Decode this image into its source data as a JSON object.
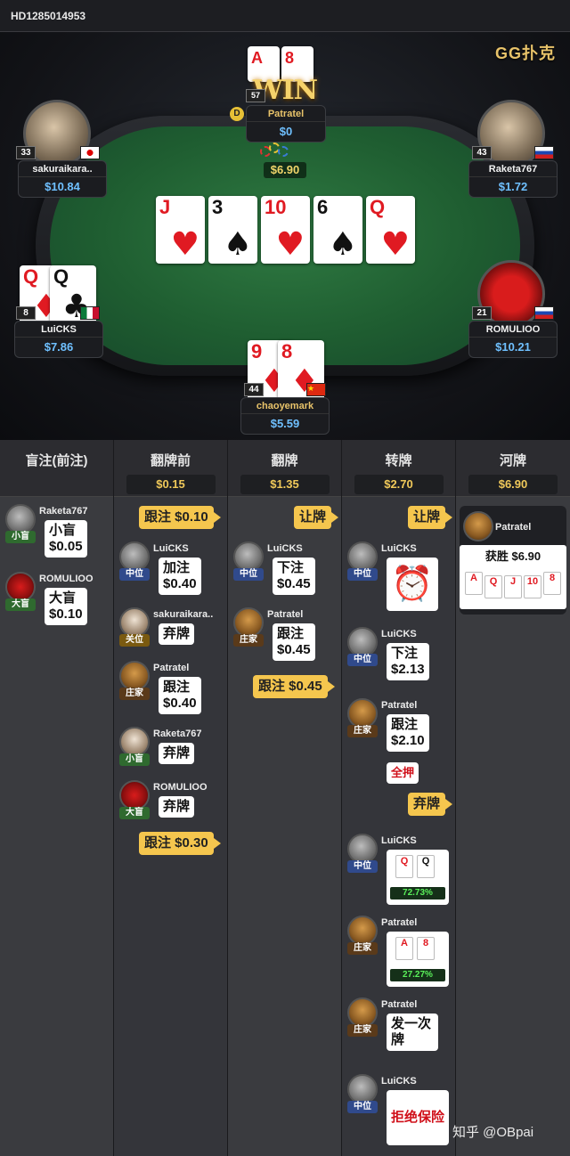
{
  "hand_id": "HD1285014953",
  "brand": "GG扑克",
  "win_badge": "WIN",
  "winner_cards": [
    {
      "rank": "A",
      "suit": "♦"
    },
    {
      "rank": "8",
      "suit": "♥"
    }
  ],
  "pot": "$6.90",
  "players": {
    "top": {
      "name": "Patratel",
      "stack": "$0",
      "level": "57",
      "dealer": "D"
    },
    "top_left": {
      "name": "sakuraikara..",
      "stack": "$10.84",
      "level": "33"
    },
    "top_right": {
      "name": "Raketa767",
      "stack": "$1.72",
      "level": "43"
    },
    "mid_left": {
      "name": "LuiCKS",
      "stack": "$7.86",
      "level": "8",
      "cards": [
        {
          "rank": "Q",
          "suit": "♦"
        },
        {
          "rank": "Q",
          "suit": "♣"
        }
      ]
    },
    "mid_right": {
      "name": "ROMULIOO",
      "stack": "$10.21",
      "level": "21"
    },
    "bottom": {
      "name": "chaoyemark",
      "stack": "$5.59",
      "level": "44",
      "cards": [
        {
          "rank": "9",
          "suit": "♦"
        },
        {
          "rank": "8",
          "suit": "♦"
        }
      ]
    }
  },
  "board": [
    {
      "rank": "J",
      "suit": "♥"
    },
    {
      "rank": "3",
      "suit": "♠"
    },
    {
      "rank": "10",
      "suit": "♥"
    },
    {
      "rank": "6",
      "suit": "♠"
    },
    {
      "rank": "Q",
      "suit": "♥"
    }
  ],
  "streets": [
    {
      "title": "盲注(前注)",
      "pot": ""
    },
    {
      "title": "翻牌前",
      "pot": "$0.15"
    },
    {
      "title": "翻牌",
      "pot": "$1.35"
    },
    {
      "title": "转牌",
      "pot": "$2.70"
    },
    {
      "title": "河牌",
      "pot": "$6.90"
    }
  ],
  "blinds": [
    {
      "name": "Raketa767",
      "pos": "小盲",
      "action": "小盲",
      "amount": "$0.05"
    },
    {
      "name": "ROMULIOO",
      "pos": "大盲",
      "action": "大盲",
      "amount": "$0.10"
    }
  ],
  "preflop": {
    "call_tag": "跟注 $0.10",
    "entries": [
      {
        "name": "LuiCKS",
        "pos": "中位",
        "action": "加注",
        "amount": "$0.40"
      },
      {
        "name": "sakuraikara..",
        "pos": "关位",
        "action": "弃牌",
        "amount": ""
      },
      {
        "name": "Patratel",
        "pos": "庄家",
        "action": "跟注",
        "amount": "$0.40"
      },
      {
        "name": "Raketa767",
        "pos": "小盲",
        "action": "弃牌",
        "amount": ""
      },
      {
        "name": "ROMULIOO",
        "pos": "大盲",
        "action": "弃牌",
        "amount": ""
      }
    ],
    "end_tag": "跟注 $0.30"
  },
  "flop": {
    "check_tag": "让牌",
    "entries": [
      {
        "name": "LuiCKS",
        "pos": "中位",
        "action": "下注",
        "amount": "$0.45"
      },
      {
        "name": "Patratel",
        "pos": "庄家",
        "action": "跟注",
        "amount": "$0.45"
      }
    ],
    "end_tag": "跟注 $0.45"
  },
  "turn": {
    "check_tag": "让牌",
    "entries": [
      {
        "name": "LuiCKS",
        "pos": "中位",
        "action": "timer-icon",
        "amount": ""
      },
      {
        "name": "LuiCKS",
        "pos": "中位",
        "action": "下注",
        "amount": "$2.13"
      },
      {
        "name": "Patratel",
        "pos": "庄家",
        "action": "跟注",
        "amount": "$2.10"
      }
    ],
    "allin": "全押",
    "fold_tag": "弃牌",
    "showdown": [
      {
        "name": "LuiCKS",
        "pos": "中位",
        "cards": [
          "Q",
          "Q"
        ],
        "equity": "72.73%"
      },
      {
        "name": "Patratel",
        "pos": "庄家",
        "cards": [
          "A",
          "8"
        ],
        "equity": "27.27%"
      }
    ],
    "run_twice": {
      "name": "Patratel",
      "pos": "庄家",
      "text": "发一次牌"
    },
    "insurance": {
      "name": "LuiCKS",
      "pos": "中位",
      "text": "拒绝保险"
    }
  },
  "river": {
    "winner": "Patratel",
    "result": "获胜 $6.90",
    "cards": [
      "A",
      "Q",
      "J",
      "10",
      "8"
    ]
  },
  "watermark": "知乎 @OBpai",
  "colors": {
    "accent": "#f5c64e",
    "stack": "#6fc0ff",
    "felt": "#1f5e31"
  }
}
